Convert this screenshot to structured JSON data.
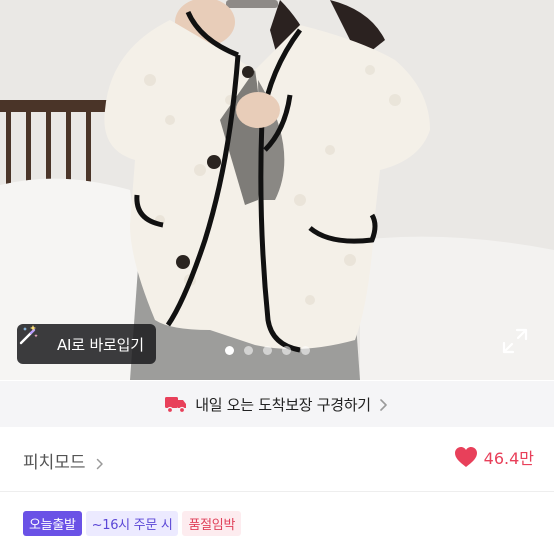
{
  "product_image": {
    "alt": "",
    "try_on_button": {
      "label": "AI로 바로입기",
      "icon": "magic-wand-icon"
    },
    "carousel": {
      "count": 5,
      "active_index": 0
    },
    "expand_icon": "expand-icon"
  },
  "delivery_banner": {
    "icon": "delivery-truck-icon",
    "text": "내일 오는 도착보장 구경하기",
    "chevron": "chevron-right-icon"
  },
  "shop": {
    "name": "피치모드",
    "chevron": "chevron-right-icon",
    "likes": {
      "icon": "heart-icon",
      "count": "46.4만",
      "color": "#e8405a"
    }
  },
  "badges": [
    {
      "label": "오늘출발",
      "bg": "#6a52e6",
      "color": "#ffffff"
    },
    {
      "label": "~16시 주문 시",
      "bg": "#eceaff",
      "color": "#5b47d6"
    },
    {
      "label": "품절임박",
      "bg": "#fdecef",
      "color": "#e0425b"
    }
  ]
}
